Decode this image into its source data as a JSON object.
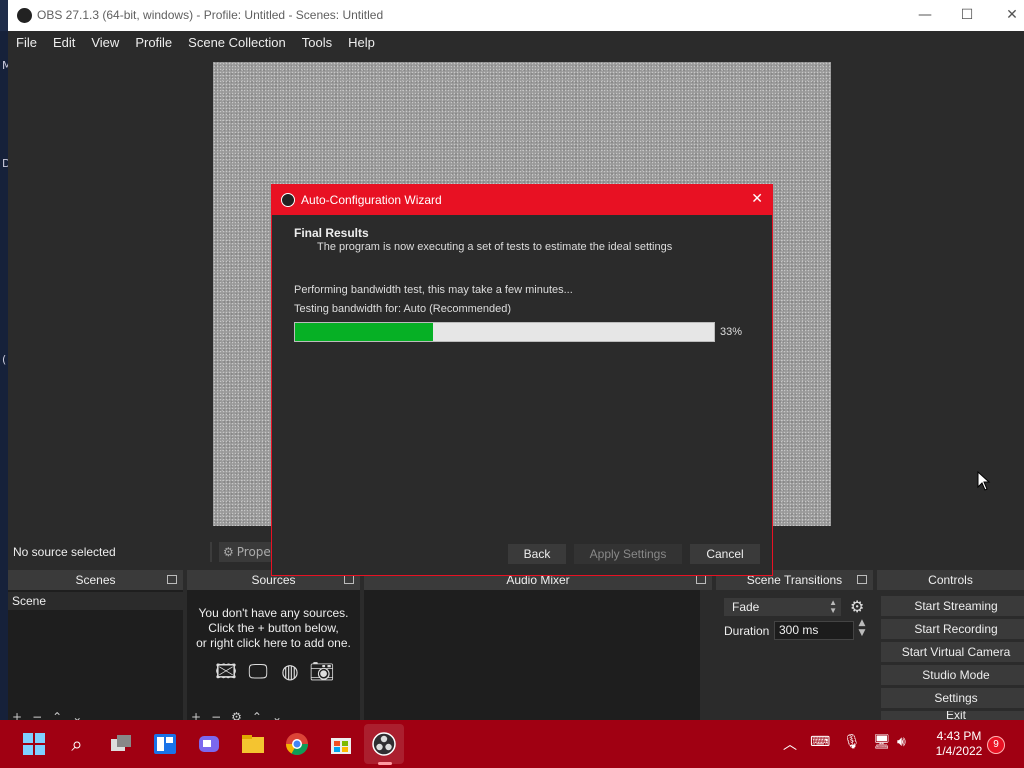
{
  "window": {
    "title": "OBS 27.1.3 (64-bit, windows) - Profile: Untitled - Scenes: Untitled",
    "controls": {
      "minimize": "—",
      "maximize": "☐",
      "close": "✕"
    }
  },
  "menu": [
    "File",
    "Edit",
    "View",
    "Profile",
    "Scene Collection",
    "Tools",
    "Help"
  ],
  "desktop_edge": [
    "M",
    "D",
    "("
  ],
  "source_bar": {
    "no_source": "No source selected",
    "properties_label": "Proper"
  },
  "docks": {
    "scenes": {
      "title": "Scenes",
      "items": [
        "Scene"
      ]
    },
    "sources": {
      "title": "Sources",
      "empty_line1": "You don't have any sources.",
      "empty_line2": "Click the + button below,",
      "empty_line3": "or right click here to add one."
    },
    "audio_mixer": {
      "title": "Audio Mixer"
    },
    "transitions": {
      "title": "Scene Transitions",
      "selected": "Fade",
      "duration_label": "Duration",
      "duration_value": "300 ms"
    },
    "controls": {
      "title": "Controls",
      "buttons": [
        "Start Streaming",
        "Start Recording",
        "Start Virtual Camera",
        "Studio Mode",
        "Settings",
        "Exit"
      ]
    }
  },
  "dialog": {
    "title": "Auto-Configuration Wizard",
    "heading": "Final Results",
    "subtitle": "The program is now executing a set of tests to estimate the ideal settings",
    "status_line": "Performing bandwidth test, this may take a few minutes...",
    "testing_line": "Testing bandwidth for: Auto (Recommended)",
    "progress_percent": 33,
    "progress_label": "33%",
    "buttons": {
      "back": "Back",
      "apply": "Apply Settings",
      "cancel": "Cancel"
    },
    "close_glyph": "✕"
  },
  "taskbar": {
    "time": "4:43 PM",
    "date": "1/4/2022",
    "notification_count": "9"
  },
  "colors": {
    "accent": "#e81123",
    "taskbar": "#a00012",
    "progress": "#06b025"
  }
}
